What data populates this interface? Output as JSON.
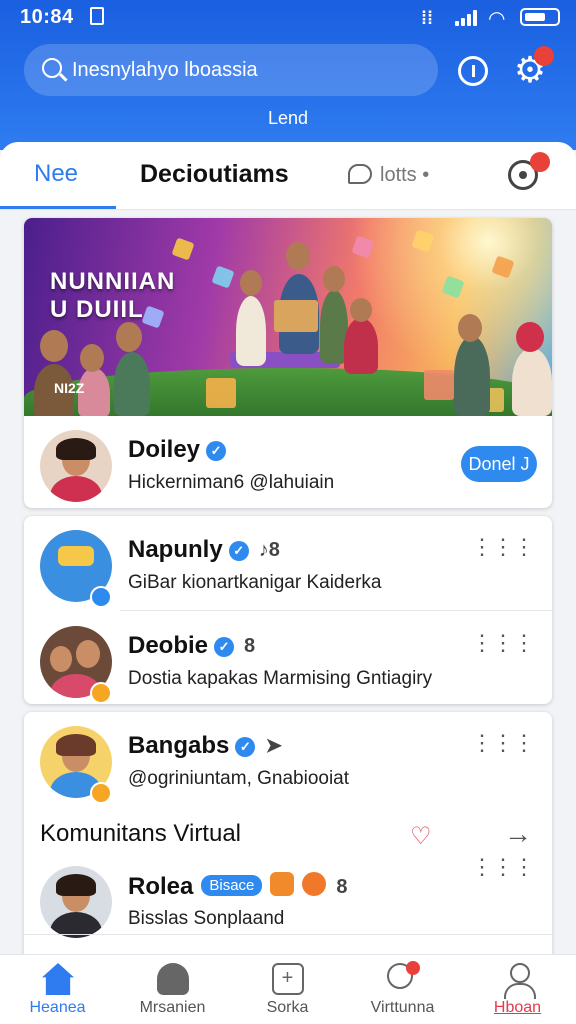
{
  "status_bar": {
    "time": "10:84"
  },
  "header": {
    "search_placeholder": "Inesnylahyo lboassia",
    "subtitle": "Lend"
  },
  "tabs": [
    {
      "label": "Nee",
      "active": true
    },
    {
      "label": "Decioutiams",
      "active": false
    },
    {
      "label": "lotts •",
      "active": false
    }
  ],
  "featured": {
    "banner_text": "NUNNIIAN U DUIIL",
    "banner_tag": "NI2Z",
    "name": "Doiley",
    "subtitle": "Hickerniman6 @lahuiain",
    "button_label": "Donel J"
  },
  "list": [
    {
      "name": "Napunly",
      "extra": "♪8",
      "subtitle": "GiBar kionartkanigar Kaiderka",
      "avatar_color": "#3a8fe0"
    },
    {
      "name": "Deobie",
      "extra": "8",
      "subtitle": "Dostia kapakas Marmising Gntiagiry",
      "avatar_color": "#6b4a3a"
    }
  ],
  "community": {
    "item": {
      "name": "Bangabs",
      "subtitle": "@ogriniuntam, Gnabiooiat",
      "avatar_color": "#f5d36a"
    },
    "section_title": "Komunitans Virtual",
    "person": {
      "name": "Rolea",
      "tag": "Bisace",
      "subtitle": "Bisslas Sonplaand"
    }
  },
  "bottom_nav": [
    {
      "label": "Heanea",
      "icon": "home-icon",
      "state": "active"
    },
    {
      "label": "Mrsanien",
      "icon": "music-icon",
      "state": "normal"
    },
    {
      "label": "Sorka",
      "icon": "grid-icon",
      "state": "normal"
    },
    {
      "label": "Virttunna",
      "icon": "search-icon",
      "state": "normal"
    },
    {
      "label": "Hboan",
      "icon": "user-icon",
      "state": "alert"
    }
  ],
  "colors": {
    "primary": "#2f7cf0",
    "alert": "#e8413a",
    "header_top": "#1a5fe0"
  }
}
